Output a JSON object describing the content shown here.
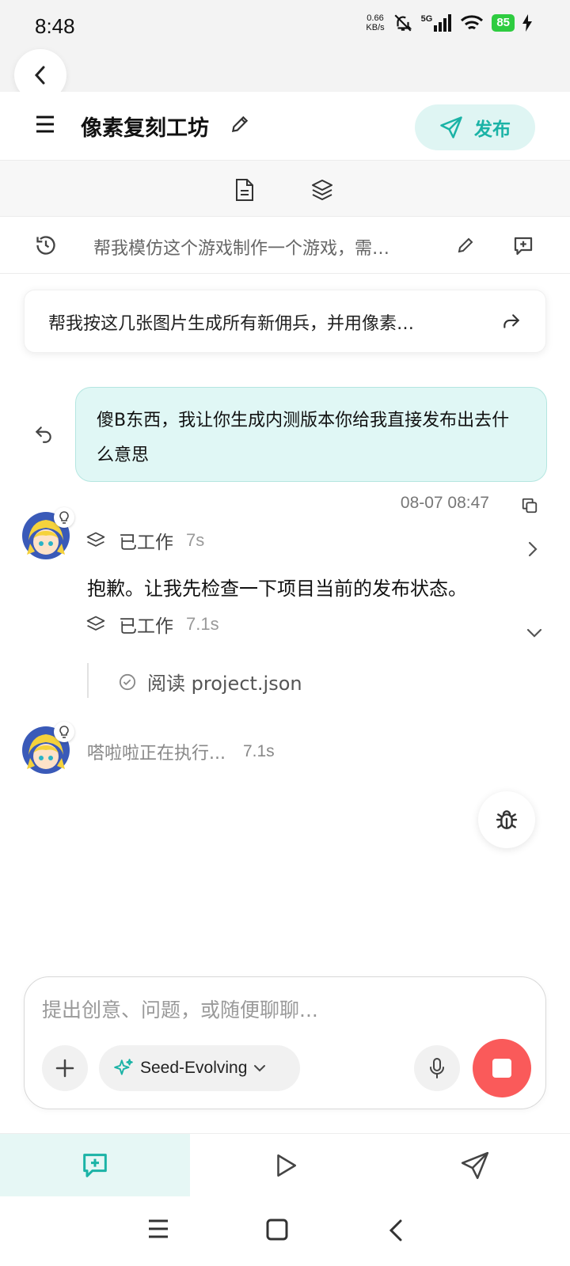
{
  "status_bar": {
    "time": "8:48",
    "net_speed_value": "0.66",
    "net_speed_unit": "KB/s",
    "network": "5G",
    "battery": "85"
  },
  "header": {
    "title": "像素复刻工坊",
    "publish_label": "发布"
  },
  "conversation": {
    "title": "帮我模仿这个游戏制作一个游戏，需…"
  },
  "prompt_card": {
    "text": "帮我按这几张图片生成所有新佣兵，并用像素…"
  },
  "messages": {
    "user_text": "傻B东西，我让你生成内测版本你给我直接发布出去什么意思",
    "timestamp": "08-07 08:47",
    "work1_label": "已工作",
    "work1_time": "7s",
    "reply": "抱歉。让我先检查一下项目当前的发布状态。",
    "work2_label": "已工作",
    "work2_time": "7.1s",
    "step_text": "阅读 project.json",
    "running_text": "嗒啦啦正在执行...",
    "running_time": "7.1s"
  },
  "composer": {
    "placeholder": "提出创意、问题，或随便聊聊...",
    "model": "Seed-Evolving"
  },
  "colors": {
    "accent": "#1bb3a6",
    "bubble": "#e0f7f5",
    "stop": "#fa5a5a"
  }
}
